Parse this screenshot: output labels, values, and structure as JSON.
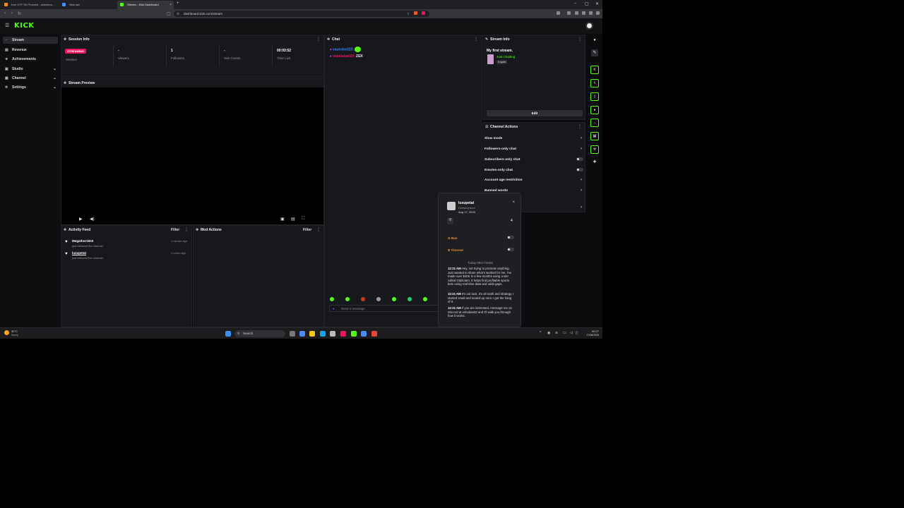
{
  "browser": {
    "tabs": [
      {
        "title": "Kee OTF Sh Proceed - selenium..."
      },
      {
        "title": "New tab"
      },
      {
        "title": "Stream - Kick Dashboard"
      }
    ],
    "url": "dashboard.kick.com/stream",
    "new_tab": "+",
    "min": "–",
    "max": "▢",
    "close": "✕"
  },
  "app": {
    "logo": "KICK"
  },
  "sidebar": {
    "items": [
      {
        "label": "Stream",
        "icon": "stream-icon",
        "glyph": "◦◦"
      },
      {
        "label": "Revenue",
        "icon": "revenue-icon",
        "glyph": "▤"
      },
      {
        "label": "Achievements",
        "icon": "trophy-icon",
        "glyph": "★"
      },
      {
        "label": "Studio",
        "icon": "studio-icon",
        "glyph": "▣"
      },
      {
        "label": "Channel",
        "icon": "channel-icon",
        "glyph": "▦"
      },
      {
        "label": "Settings",
        "icon": "gear-icon",
        "glyph": "✲"
      }
    ]
  },
  "session_info": {
    "title": "Session Info",
    "badge": "STREAMING",
    "stats": [
      {
        "value": "",
        "label": "Session"
      },
      {
        "value": "-",
        "label": "Viewers"
      },
      {
        "value": "1",
        "label": "Followers"
      },
      {
        "value": "-",
        "label": "Sub Counts"
      },
      {
        "value": "00:03:52",
        "label": "Time Live"
      }
    ]
  },
  "preview": {
    "title": "Stream Preview"
  },
  "activity_feed": {
    "title": "Activity Feed",
    "filter": "Filter",
    "items": [
      {
        "name": "Megathor1833",
        "sub": "just followed the channel",
        "time": "1 minute ago"
      },
      {
        "name": "luxupetat",
        "sub": "just followed the channel",
        "time": "3 hours ago"
      }
    ]
  },
  "mod_actions": {
    "title": "Mod Actions",
    "filter": "Filter"
  },
  "chat": {
    "title": "Chat",
    "messages": [
      {
        "user": "vasenko323:",
        "text": "",
        "color": "#3b82f6"
      },
      {
        "user": "vabelakari23:",
        "text": "ZEK",
        "color": "#e8175d"
      }
    ],
    "input_placeholder": "Send a message"
  },
  "stream_info": {
    "title": "Stream Info",
    "stream_title": "My first stream.",
    "category": "Just Chatting",
    "language": "English",
    "edit": "Edit"
  },
  "channel_actions": {
    "title": "Channel Actions",
    "items": [
      {
        "label": "Slow mode",
        "kind": "chevron"
      },
      {
        "label": "Followers-only chat",
        "kind": "chevron"
      },
      {
        "label": "Subscribers-only chat",
        "kind": "toggle"
      },
      {
        "label": "Emotes-only chat",
        "kind": "toggle"
      },
      {
        "label": "Account age restriction",
        "kind": "chevron"
      },
      {
        "label": "Banned words",
        "kind": "chevron"
      }
    ]
  },
  "popup": {
    "username": "luxupetat",
    "following_since": "Following since",
    "follow_date": "Aug 17, 2025",
    "count": "4",
    "ban": "Ban",
    "timeout": "Timeout",
    "today": "Today 08/17/2025",
    "messages": [
      {
        "time": "12:21 AM",
        "text": "Hey, not trying to promote anything. Just wanted to share what's worked for me. I've made over $40K in a few months using a site called OddsJam. It helps find profitable sports bets using real-time data and odds gaps."
      },
      {
        "time": "12:21 AM",
        "text": "It's not luck. It's all math and strategy. I started small and scaled up once I got the hang of it."
      },
      {
        "time": "12:21 AM",
        "text": "If you are interested, message me on Discord at vehodan02 and I'll walk you through how it works."
      }
    ]
  },
  "taskbar": {
    "weather_temp": "30°C",
    "weather_desc": "Sunny",
    "search": "Search",
    "time": "00:27",
    "date": "17/08/2025"
  },
  "colors": {
    "accent": "#53fc18",
    "live": "#e8175d"
  }
}
